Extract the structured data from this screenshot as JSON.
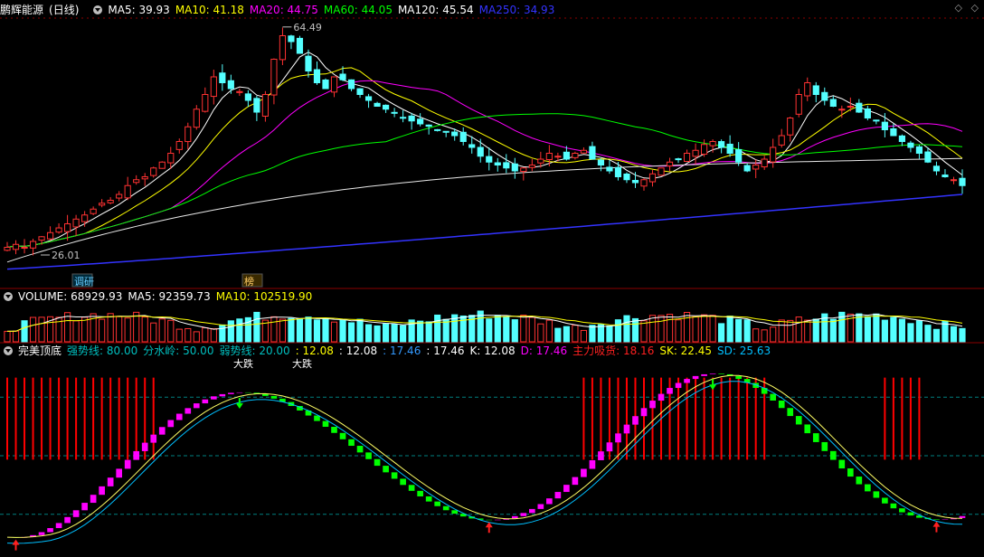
{
  "stock": {
    "name": "鹏辉能源",
    "period": "(日线)"
  },
  "main_panel": {
    "indicators": [
      {
        "label": "MA5:",
        "value": "39.93",
        "color": "#ffffff"
      },
      {
        "label": "MA10:",
        "value": "41.18",
        "color": "#ffff00"
      },
      {
        "label": "MA20:",
        "value": "44.75",
        "color": "#ff00ff"
      },
      {
        "label": "MA60:",
        "value": "44.05",
        "color": "#00ff00"
      },
      {
        "label": "MA120:",
        "value": "45.54",
        "color": "#ffffff"
      },
      {
        "label": "MA250:",
        "value": "34.93",
        "color": "#3333ff"
      }
    ],
    "high_label": "64.49",
    "low_label": "26.01",
    "markers": [
      "调研",
      "榜"
    ]
  },
  "volume_panel": {
    "items": [
      {
        "label": "VOLUME:",
        "value": "68929.93",
        "color": "#ffffff"
      },
      {
        "label": "MA5:",
        "value": "92359.73",
        "color": "#ffffff"
      },
      {
        "label": "MA10:",
        "value": "102519.90",
        "color": "#ffff00"
      }
    ]
  },
  "indicator_panel": {
    "name": "完美顶底",
    "items": [
      {
        "label": "强势线:",
        "value": "80.00",
        "color": "#00bfbf"
      },
      {
        "label": "分水岭:",
        "value": "50.00",
        "color": "#00bfbf"
      },
      {
        "label": "弱势线:",
        "value": "20.00",
        "color": "#00bfbf"
      },
      {
        "label": ":",
        "value": "12.08",
        "color": "#ffff00"
      },
      {
        "label": ":",
        "value": "12.08",
        "color": "#ffffff"
      },
      {
        "label": ":",
        "value": "17.46",
        "color": "#3399ff"
      },
      {
        "label": ":",
        "value": "17.46",
        "color": "#ffffff"
      },
      {
        "label": "K:",
        "value": "12.08",
        "color": "#ffffff"
      },
      {
        "label": "D:",
        "value": "17.46",
        "color": "#ff00ff"
      },
      {
        "label": "主力吸货:",
        "value": "18.16",
        "color": "#ff2020"
      },
      {
        "label": "SK:",
        "value": "22.45",
        "color": "#ffff00"
      },
      {
        "label": "SD:",
        "value": "25.63",
        "color": "#00bfff"
      }
    ],
    "signals": [
      "大跌",
      "大跌"
    ]
  },
  "colors": {
    "up": "#ff3232",
    "down": "#54ffff",
    "grid": "#8b0000",
    "pink": "#ff00ff",
    "green": "#00ff00",
    "red_bar": "#ff0000"
  },
  "chart_data": {
    "type": "candlestick",
    "price_range": [
      22,
      66
    ],
    "volume_range": [
      0,
      260000
    ],
    "oscillator_range": [
      0,
      100
    ],
    "candles_close": [
      27,
      27.5,
      27,
      28,
      28.8,
      29.5,
      30.3,
      31,
      31.8,
      32.5,
      33.5,
      34.5,
      35,
      36,
      37.5,
      38.5,
      39,
      40.5,
      41.5,
      43,
      45,
      47.5,
      50.5,
      53,
      56,
      55,
      54,
      53.5,
      52,
      50,
      53,
      59,
      63,
      62,
      60,
      57,
      55,
      54,
      56,
      55.5,
      54,
      53,
      52,
      51,
      50.5,
      49.8,
      49,
      48.5,
      48,
      47.6,
      47,
      46.7,
      46,
      45,
      44,
      42.5,
      41.5,
      41,
      40.5,
      40,
      40.5,
      41,
      42,
      43,
      42.5,
      42,
      43,
      43.5,
      42,
      41,
      40,
      39,
      38.5,
      38,
      38.5,
      39.5,
      40.5,
      41.5,
      42,
      43,
      43.5,
      44.5,
      45,
      44,
      43,
      41.5,
      40,
      41,
      42,
      44,
      46,
      49,
      53,
      55,
      53,
      52,
      51,
      50.5,
      51,
      50,
      49,
      48.5,
      47,
      46,
      45,
      44,
      43,
      41.5,
      40,
      39,
      38.5,
      37.5
    ],
    "annotations": {
      "high": 64.49,
      "low": 26.01
    },
    "ma_values": {
      "MA5": 39.93,
      "MA10": 41.18,
      "MA20": 44.75,
      "MA60": 44.05,
      "MA120": 45.54,
      "MA250": 34.93
    },
    "oscillator_levels": {
      "strong": 80,
      "watershed": 50,
      "weak": 20
    }
  }
}
